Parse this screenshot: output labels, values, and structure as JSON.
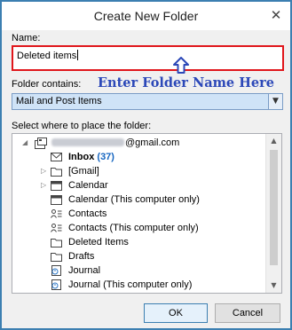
{
  "window": {
    "title": "Create New Folder",
    "close_glyph": "✕"
  },
  "name": {
    "label": "Name:",
    "value": "Deleted items"
  },
  "annotation": {
    "text": "Enter Folder Name Here",
    "arrow": "⇧",
    "color": "#2c48b8"
  },
  "folder_contains": {
    "label": "Folder contains:",
    "value": "Mail and Post Items"
  },
  "tree": {
    "label": "Select where to place the folder:",
    "account_suffix": "@gmail.com",
    "items": [
      {
        "label": "Inbox",
        "count": "(37)",
        "icon": "envelope-icon",
        "bold": true
      },
      {
        "label": "[Gmail]",
        "icon": "folder-icon",
        "expandable": true
      },
      {
        "label": "Calendar",
        "icon": "calendar-icon",
        "expandable": true
      },
      {
        "label": "Calendar (This computer only)",
        "icon": "calendar-icon"
      },
      {
        "label": "Contacts",
        "icon": "contacts-icon"
      },
      {
        "label": "Contacts (This computer only)",
        "icon": "contacts-icon"
      },
      {
        "label": "Deleted Items",
        "icon": "folder-icon"
      },
      {
        "label": "Drafts",
        "icon": "folder-icon"
      },
      {
        "label": "Journal",
        "icon": "journal-icon"
      },
      {
        "label": "Journal (This computer only)",
        "icon": "journal-icon"
      }
    ]
  },
  "buttons": {
    "ok": "OK",
    "cancel": "Cancel"
  },
  "colors": {
    "highlight_border": "#e0161b",
    "select_bg": "#cfe3f7",
    "count": "#1565c0"
  }
}
